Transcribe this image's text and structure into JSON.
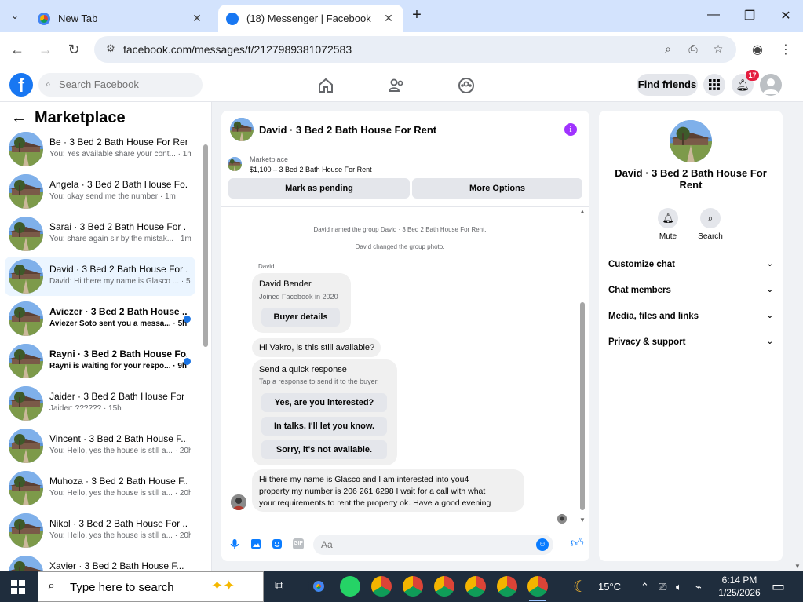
{
  "browser": {
    "tabs": [
      {
        "title": "New Tab",
        "active": false
      },
      {
        "title": "(18) Messenger | Facebook",
        "active": true
      }
    ],
    "url": "facebook.com/messages/t/2127989381072583"
  },
  "fb": {
    "search_placeholder": "Search Facebook",
    "find_friends": "Find friends",
    "notification_count": "17"
  },
  "sidebar": {
    "title": "Marketplace",
    "conversations": [
      {
        "name": "Be · 3 Bed 2 Bath House For Rent",
        "preview": "You: Yes available share your cont... · 1m",
        "unread": false,
        "selected": false
      },
      {
        "name": "Angela · 3 Bed 2 Bath House Fo...",
        "preview": "You: okay send me the number · 1m",
        "unread": false,
        "selected": false
      },
      {
        "name": "Sarai · 3 Bed 2 Bath House For ...",
        "preview": "You: share again sir by the mistak... · 1m",
        "unread": false,
        "selected": false
      },
      {
        "name": "David · 3 Bed 2 Bath House For ...",
        "preview": "David: Hi there my name is Glasco ... · 5h",
        "unread": false,
        "selected": true
      },
      {
        "name": "Aviezer · 3 Bed 2 Bath House ...",
        "preview": "Aviezer Soto sent you a messa... · 5h",
        "unread": true,
        "selected": false
      },
      {
        "name": "Rayni · 3 Bed 2 Bath House Fo...",
        "preview": "Rayni is waiting for your respo... · 9h",
        "unread": true,
        "selected": false
      },
      {
        "name": "Jaider · 3 Bed 2 Bath House For ...",
        "preview": "Jaider: ?????? · 15h",
        "unread": false,
        "selected": false
      },
      {
        "name": "Vincent · 3 Bed 2 Bath House F...",
        "preview": "You: Hello, yes the house is still a... · 20h",
        "unread": false,
        "selected": false
      },
      {
        "name": "Muhoza · 3 Bed 2 Bath House F...",
        "preview": "You: Hello, yes the house is still a... · 20h",
        "unread": false,
        "selected": false
      },
      {
        "name": "Nikol · 3 Bed 2 Bath House For ...",
        "preview": "You: Hello, yes the house is still a... · 20h",
        "unread": false,
        "selected": false
      },
      {
        "name": "Xavier · 3 Bed 2 Bath House F...",
        "preview": "",
        "unread": false,
        "selected": false
      }
    ]
  },
  "chat": {
    "title": "David · 3 Bed 2 Bath House For Rent",
    "marketplace_label": "Marketplace",
    "listing": "$1,100 – 3 Bed 2 Bath House For Rent",
    "mark_pending": "Mark as pending",
    "more_options": "More Options",
    "system_messages": [
      "David named the group David · 3 Bed 2 Bath House For Rent.",
      "David changed the group photo."
    ],
    "sender_label": "David",
    "profile_card": {
      "name": "David Bender",
      "joined": "Joined Facebook in 2020",
      "button": "Buyer details"
    },
    "message1": "Hi Vakro, is this still available?",
    "quick_response": {
      "title": "Send a quick response",
      "subtitle": "Tap a response to send it to the buyer.",
      "options": [
        "Yes, are you interested?",
        "In talks. I'll let you know.",
        "Sorry, it's not available."
      ]
    },
    "message2_lines": [
      "Hi there my name is Glasco and I am interested into you4",
      "property my number is 206 261 6298 I wait for a call with what",
      "your requirements to rent the property ok. Have a good evening"
    ],
    "composer_placeholder": "Aa"
  },
  "details": {
    "name": "David · 3 Bed 2 Bath House For Rent",
    "actions": [
      "Mute",
      "Search"
    ],
    "sections": [
      "Customize chat",
      "Chat members",
      "Media, files and links",
      "Privacy & support"
    ]
  },
  "taskbar": {
    "search_text": "Type here to search",
    "weather": "15°C",
    "time": "6:14 PM",
    "date": "1/25/2026"
  },
  "colors": {
    "fb_blue": "#1877f2",
    "messenger_blue": "#0a7cff",
    "info_purple": "#a033ff",
    "badge_red": "#e41e3f",
    "selected_row": "#ebf5ff"
  }
}
